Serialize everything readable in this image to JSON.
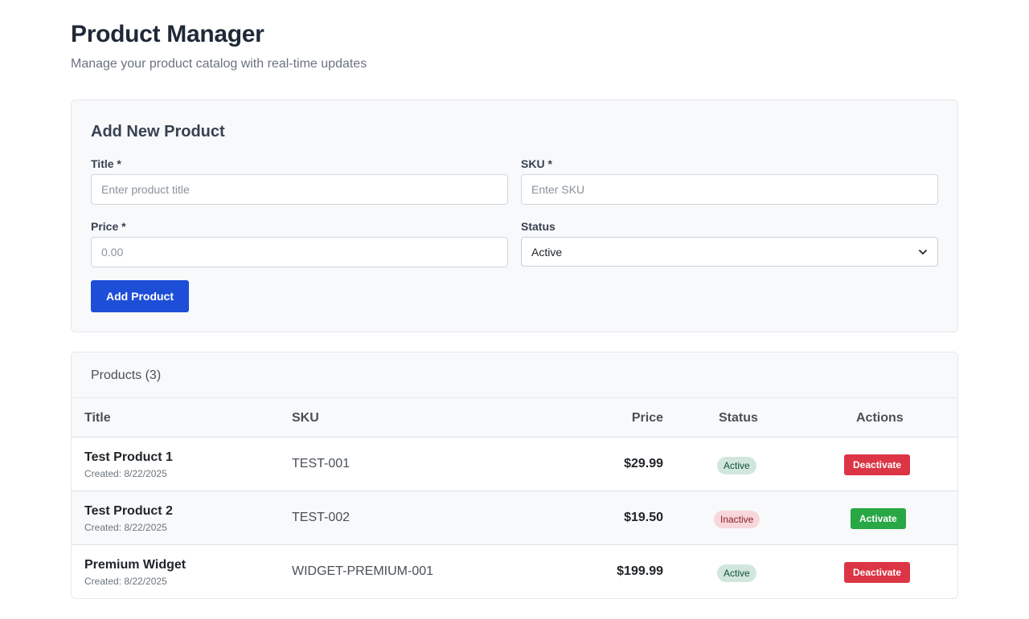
{
  "header": {
    "title": "Product Manager",
    "subtitle": "Manage your product catalog with real-time updates"
  },
  "form": {
    "heading": "Add New Product",
    "title_label": "Title *",
    "title_placeholder": "Enter product title",
    "sku_label": "SKU *",
    "sku_placeholder": "Enter SKU",
    "price_label": "Price *",
    "price_placeholder": "0.00",
    "status_label": "Status",
    "status_value": "Active",
    "submit_label": "Add Product"
  },
  "products": {
    "count_label": "Products (3)",
    "columns": [
      "Title",
      "SKU",
      "Price",
      "Status",
      "Actions"
    ],
    "rows": [
      {
        "title": "Test Product 1",
        "created": "Created: 8/22/2025",
        "sku": "TEST-001",
        "price": "$29.99",
        "status": "Active",
        "action": "Deactivate"
      },
      {
        "title": "Test Product 2",
        "created": "Created: 8/22/2025",
        "sku": "TEST-002",
        "price": "$19.50",
        "status": "Inactive",
        "action": "Activate"
      },
      {
        "title": "Premium Widget",
        "created": "Created: 8/22/2025",
        "sku": "WIDGET-PREMIUM-001",
        "price": "$199.99",
        "status": "Active",
        "action": "Deactivate"
      }
    ]
  },
  "colors": {
    "primary": "#1d4ed8",
    "danger": "#dc3545",
    "success": "#28a745",
    "active_badge_bg": "#d1e7dd",
    "inactive_badge_bg": "#f8d7da"
  },
  "icons": {
    "status_select": "chevron-down-icon"
  }
}
